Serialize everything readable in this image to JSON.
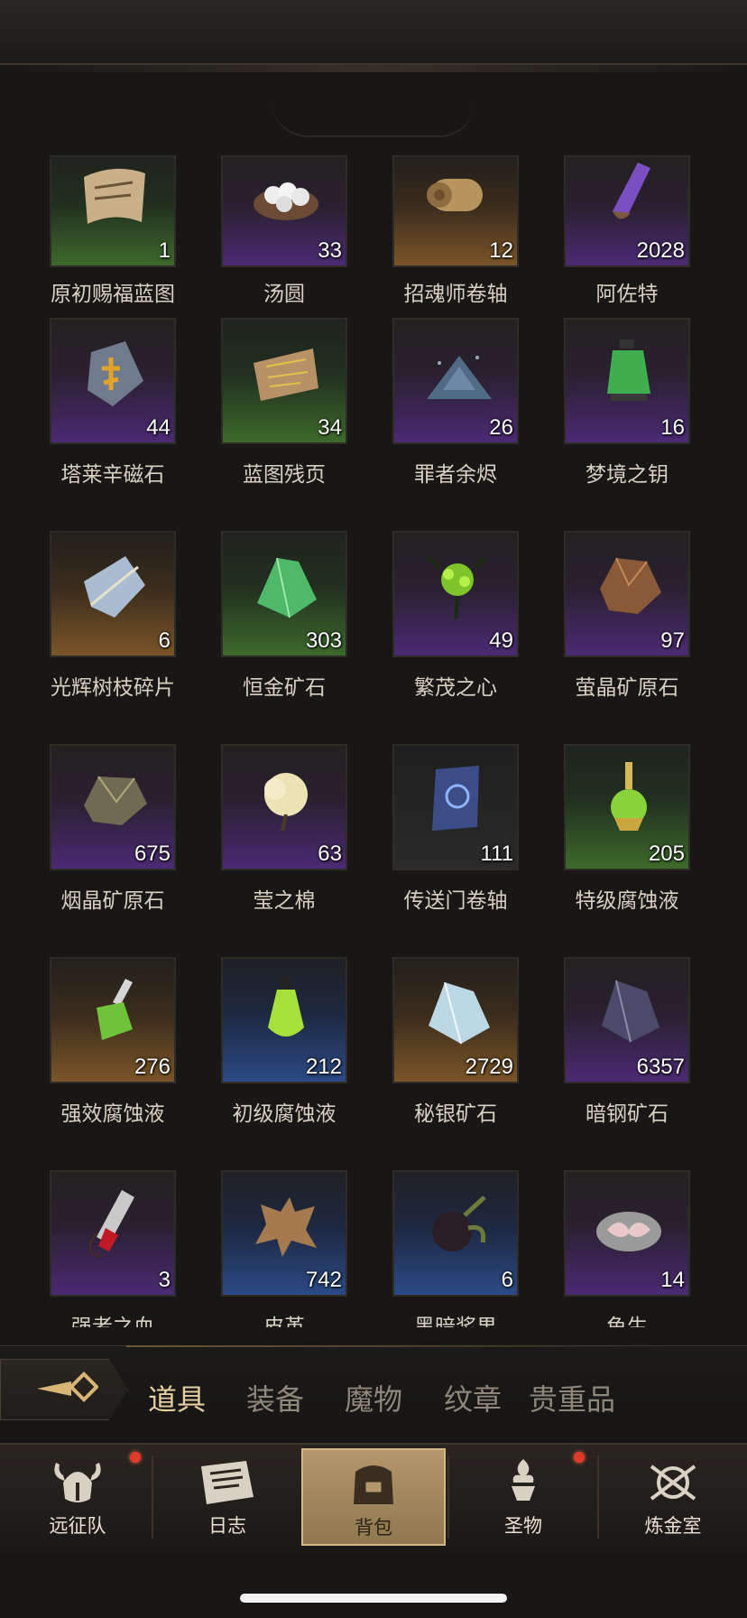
{
  "items": [
    {
      "name": "原初赐福蓝图",
      "count": "1",
      "rarity": "green",
      "icon": "scroll-blueprint"
    },
    {
      "name": "汤圆",
      "count": "33",
      "rarity": "purple",
      "icon": "dumplings-bowl"
    },
    {
      "name": "招魂师卷轴",
      "count": "12",
      "rarity": "orange",
      "icon": "rolled-scroll"
    },
    {
      "name": "阿佐特",
      "count": "2028",
      "rarity": "purple",
      "icon": "purple-crystal"
    },
    {
      "name": "塔莱辛磁石",
      "count": "44",
      "rarity": "purple",
      "icon": "rune-stone"
    },
    {
      "name": "蓝图残页",
      "count": "34",
      "rarity": "green",
      "icon": "torn-page"
    },
    {
      "name": "罪者余烬",
      "count": "26",
      "rarity": "purple",
      "icon": "ember-pile"
    },
    {
      "name": "梦境之钥",
      "count": "16",
      "rarity": "purple",
      "icon": "green-lantern"
    },
    {
      "name": "光辉树枝碎片",
      "count": "6",
      "rarity": "orange",
      "icon": "branch-shard"
    },
    {
      "name": "恒金矿石",
      "count": "303",
      "rarity": "green",
      "icon": "green-ore"
    },
    {
      "name": "繁茂之心",
      "count": "49",
      "rarity": "purple",
      "icon": "verdant-heart"
    },
    {
      "name": "萤晶矿原石",
      "count": "97",
      "rarity": "purple",
      "icon": "amber-ore"
    },
    {
      "name": "烟晶矿原石",
      "count": "675",
      "rarity": "purple",
      "icon": "smoky-ore"
    },
    {
      "name": "莹之棉",
      "count": "63",
      "rarity": "purple",
      "icon": "cotton"
    },
    {
      "name": "传送门卷轴",
      "count": "111",
      "rarity": "gray",
      "icon": "portal-scroll"
    },
    {
      "name": "特级腐蚀液",
      "count": "205",
      "rarity": "green",
      "icon": "corrosive-flask-gold"
    },
    {
      "name": "强效腐蚀液",
      "count": "276",
      "rarity": "orange",
      "icon": "corrosive-flask"
    },
    {
      "name": "初级腐蚀液",
      "count": "212",
      "rarity": "blue",
      "icon": "green-potion"
    },
    {
      "name": "秘银矿石",
      "count": "2729",
      "rarity": "orange",
      "icon": "mithril-ore"
    },
    {
      "name": "暗钢矿石",
      "count": "6357",
      "rarity": "purple",
      "icon": "darksteel-ore"
    },
    {
      "name": "强者之血",
      "count": "3",
      "rarity": "purple",
      "icon": "blood-vial"
    },
    {
      "name": "皮革",
      "count": "742",
      "rarity": "blue",
      "icon": "leather-hide"
    },
    {
      "name": "黑暗浆果",
      "count": "6",
      "rarity": "blue",
      "icon": "dark-berry"
    },
    {
      "name": "鱼生",
      "count": "14",
      "rarity": "purple",
      "icon": "raw-fish"
    }
  ],
  "tabs": [
    "道具",
    "装备",
    "魔物",
    "纹章",
    "贵重品"
  ],
  "active_tab": "道具",
  "nav": [
    {
      "label": "远征队",
      "icon": "viking-helmet-icon",
      "badge": true
    },
    {
      "label": "日志",
      "icon": "journal-icon",
      "badge": false
    },
    {
      "label": "背包",
      "icon": "backpack-icon",
      "badge": false,
      "active": true
    },
    {
      "label": "圣物",
      "icon": "relic-icon",
      "badge": true
    },
    {
      "label": "炼金室",
      "icon": "alchemy-icon",
      "badge": false
    }
  ],
  "colors": {
    "accent": "#e6cfa0",
    "badge": "#e13a2a",
    "active_nav": "#b4976a"
  }
}
